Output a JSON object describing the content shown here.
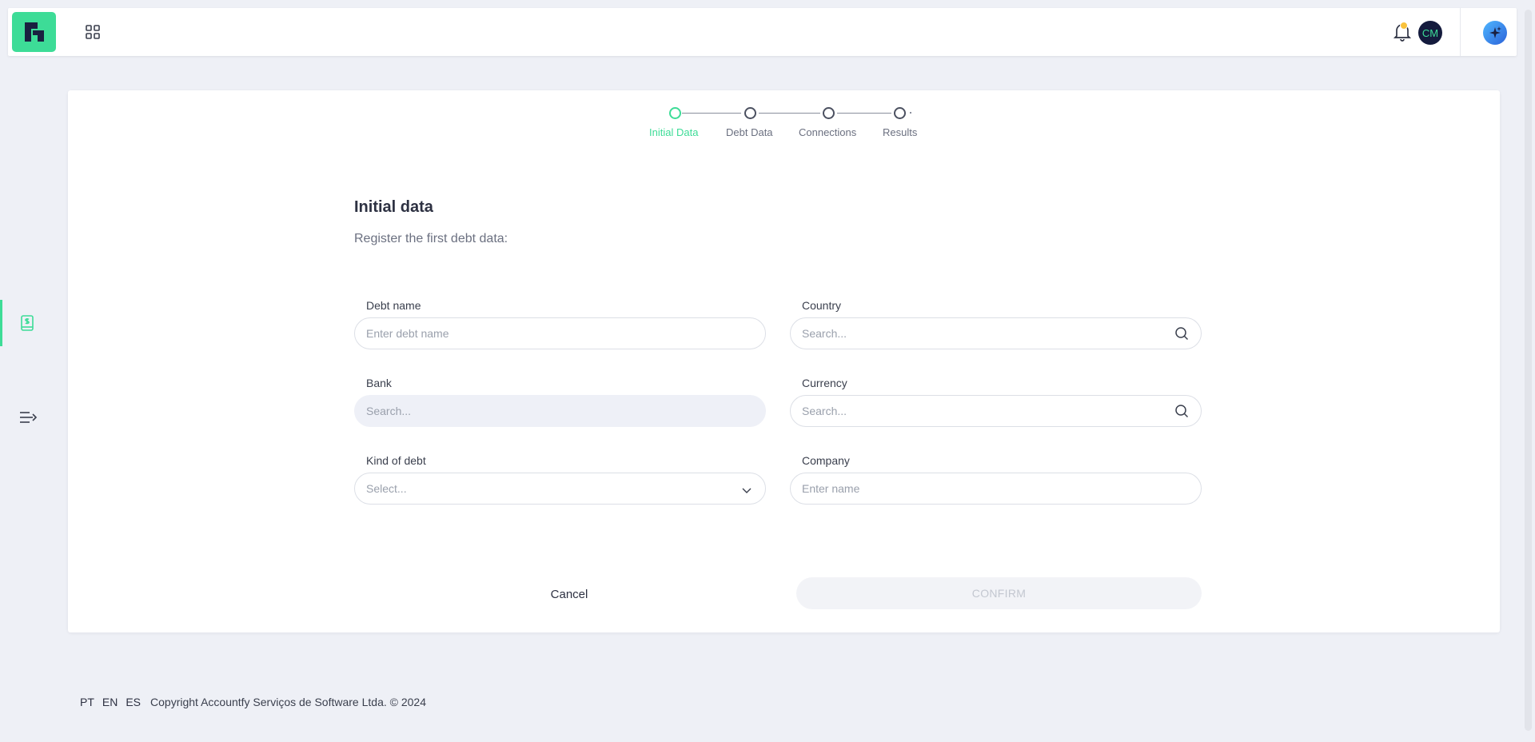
{
  "topbar": {
    "logo_icon": "accountfy-logo-icon",
    "apps_icon": "grid-apps-icon",
    "bell_icon": "bell-icon",
    "avatar_initials": "CM",
    "ai_icon": "sparkle-icon",
    "brand_color": "#3ddc97",
    "notification_dot_color": "#f9c23c"
  },
  "sidebar": {
    "items": [
      {
        "icon": "dollar-book-icon",
        "active": true
      },
      {
        "icon": "expand-menu-icon",
        "active": false
      }
    ]
  },
  "stepper": {
    "steps": [
      {
        "label": "Initial Data",
        "active": true
      },
      {
        "label": "Debt Data",
        "active": false
      },
      {
        "label": "Connections",
        "active": false
      },
      {
        "label": "Results",
        "active": false
      }
    ]
  },
  "form": {
    "title": "Initial data",
    "subtitle": "Register the first debt data:",
    "debt_name": {
      "label": "Debt name",
      "placeholder": "Enter debt name",
      "value": ""
    },
    "country": {
      "label": "Country",
      "placeholder": "Search...",
      "value": ""
    },
    "bank": {
      "label": "Bank",
      "placeholder": "Search...",
      "value": ""
    },
    "currency": {
      "label": "Currency",
      "placeholder": "Search...",
      "value": ""
    },
    "kind_of_debt": {
      "label": "Kind of debt",
      "placeholder": "Select..."
    },
    "company": {
      "label": "Company",
      "placeholder": "Enter name",
      "value": ""
    },
    "cancel_label": "Cancel",
    "confirm_label": "CONFIRM"
  },
  "footer": {
    "languages": [
      "PT",
      "EN",
      "ES"
    ],
    "copyright": "Copyright Accountfy Serviços de Software Ltda. © 2024"
  }
}
